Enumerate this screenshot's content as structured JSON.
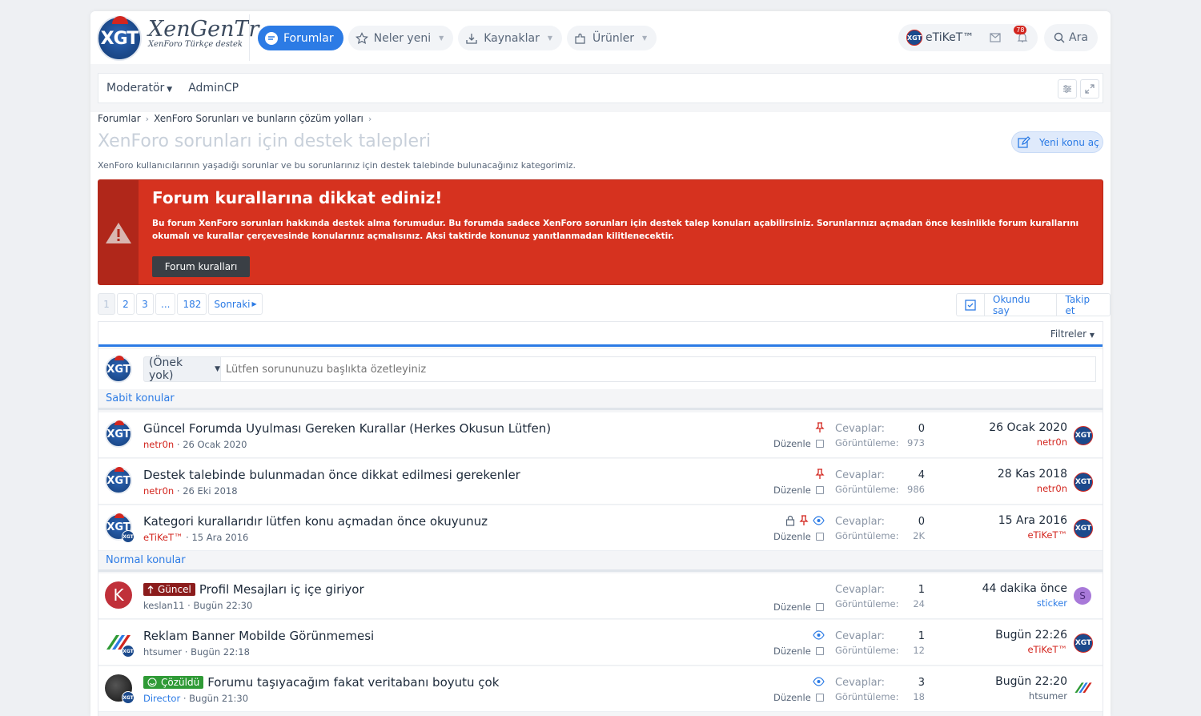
{
  "header": {
    "logo_mark": "XGT",
    "logo_title": "XenGenTr",
    "logo_subtitle": "XenForo Türkçe destek",
    "nav": [
      {
        "label": "Forumlar",
        "icon": "chat-bubble-icon",
        "active": true
      },
      {
        "label": "Neler yeni",
        "icon": "star-icon"
      },
      {
        "label": "Kaynaklar",
        "icon": "download-tray-icon"
      },
      {
        "label": "Ürünler",
        "icon": "puzzle-icon"
      }
    ],
    "user": {
      "name": "eTiKeT™",
      "alert_count": "78"
    },
    "search_label": "Ara"
  },
  "subnav": {
    "items": [
      "Moderatör",
      "AdminCP"
    ]
  },
  "breadcrumb": [
    "Forumlar",
    "XenForo Sorunları ve bunların çözüm yolları"
  ],
  "page": {
    "title": "XenForo sorunları için destek talepleri",
    "description": "XenForo kullanıcılarının yaşadığı sorunlar ve bu sorunlarınız için destek talebinde bulunacağınız kategorimiz.",
    "new_thread": "Yeni konu aç"
  },
  "notice": {
    "title": "Forum kurallarına dikkat ediniz!",
    "body": "Bu forum XenForo sorunları hakkında destek alma forumudur. Bu forumda sadece XenForo sorunları için destek talep konuları açabilirsiniz. Sorunlarınızı açmadan önce kesinlikle forum kurallarını okumalı ve kurallar çerçevesinde konularınız açmalısınız. Aksi taktirde konunuz yanıtlanmadan kilitlenecektir.",
    "button": "Forum kuralları"
  },
  "pager": {
    "pages": [
      "1",
      "2",
      "3",
      "...",
      "182"
    ],
    "next": "Sonraki",
    "mark_read": "Okundu say",
    "watch": "Takip et"
  },
  "list": {
    "filters": "Filtreler",
    "prefix_select": "(Önek yok)",
    "title_placeholder": "Lütfen sorununuzu başlıkta özetleyiniz",
    "sticky_heading": "Sabit konular",
    "normal_heading": "Normal konular",
    "edit_label": "Düzenle",
    "replies_label": "Cevaplar:",
    "views_label": "Görüntüleme:",
    "sticky": [
      {
        "title": "Güncel Forumda Uyulması Gereken Kurallar (Herkes Okusun Lütfen)",
        "author": "netr0n",
        "date": "26 Ocak 2020",
        "replies": "0",
        "views": "973",
        "last_date": "26 Ocak 2020",
        "last_user": "netr0n"
      },
      {
        "title": "Destek talebinde bulunmadan önce dikkat edilmesi gerekenler",
        "author": "netr0n",
        "date": "26 Eki 2018",
        "replies": "4",
        "views": "986",
        "last_date": "28 Kas 2018",
        "last_user": "netr0n"
      },
      {
        "title": "Kategori kurallarıdır lütfen konu açmadan önce okuyunuz",
        "author": "eTiKeT™",
        "date": "15 Ara 2016",
        "replies": "0",
        "views": "2K",
        "last_date": "15 Ara 2016",
        "last_user": "eTiKeT™"
      }
    ],
    "normal": [
      {
        "prefix": "Güncel",
        "title": "Profil Mesajları iç içe giriyor",
        "author": "keslan11",
        "date": "Bugün 22:30",
        "replies": "1",
        "views": "24",
        "last_date": "44 dakika önce",
        "last_user": "sticker",
        "avatar_letter": "K",
        "last_avatar_letter": "S"
      },
      {
        "prefix": "",
        "title": "Reklam Banner Mobilde Görünmemesi",
        "author": "htsumer",
        "date": "Bugün 22:18",
        "replies": "1",
        "views": "12",
        "last_date": "Bugün 22:26",
        "last_user": "eTiKeT™"
      },
      {
        "prefix": "Çözüldü",
        "title": "Forumu taşıyacağım fakat veritabanı boyutu çok",
        "author": "Director",
        "date": "Bugün 21:30",
        "replies": "3",
        "views": "18",
        "last_date": "Bugün 22:20",
        "last_user": "htsumer"
      }
    ]
  },
  "colors": {
    "accent": "#2c7be5",
    "notice": "#d6321f",
    "username": "#d3261f"
  }
}
